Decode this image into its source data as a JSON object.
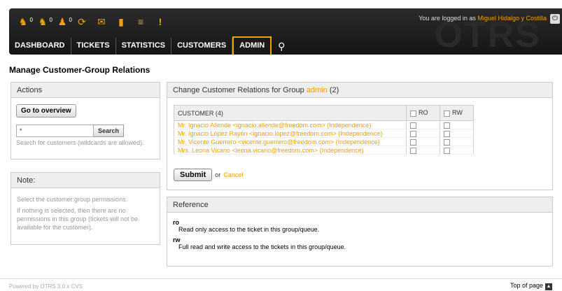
{
  "toolbar": {
    "icons": [
      {
        "name": "ticket-locked-icon",
        "count": "0"
      },
      {
        "name": "ticket-watched-icon",
        "count": "0"
      },
      {
        "name": "ticket-responsible-icon",
        "count": "0"
      },
      {
        "name": "refresh-icon",
        "count": ""
      },
      {
        "name": "email-icon",
        "count": ""
      },
      {
        "name": "folder-icon",
        "count": ""
      },
      {
        "name": "list-icon",
        "count": ""
      },
      {
        "name": "alert-icon",
        "count": ""
      }
    ],
    "logged_in_prefix": "You are logged in as",
    "user_name": "Miguel Hidalgo y Costilla",
    "logo_text": "OTRS"
  },
  "nav": {
    "items": [
      "DASHBOARD",
      "TICKETS",
      "STATISTICS",
      "CUSTOMERS",
      "ADMIN"
    ],
    "active": "ADMIN"
  },
  "page": {
    "title": "Manage Customer-Group Relations"
  },
  "actions": {
    "heading": "Actions",
    "overview_button": "Go to overview",
    "search_value": "*",
    "search_button": "Search",
    "search_hint": "Search for customers (wildcards are allowed)."
  },
  "note": {
    "heading": "Note:",
    "line1": "Select the customer:group permissions.",
    "line2": "If nothing is selected, then there are no permissions in this group (tickets will not be available for the customer)."
  },
  "relations": {
    "heading_prefix": "Change Customer Relations for Group",
    "group": "admin",
    "count": "(2)",
    "col_customer": "CUSTOMER (4)",
    "col_ro": "RO",
    "col_rw": "RW",
    "rows": [
      "Mr. Ignacio Allende <ignacio.allende@freedom.com> (Independence)",
      "Mr. Ignacio López Rayón <ignacio.lopez@freedom.com> (Independence)",
      "Mr. Vicente Guerrero <vicente.guerrero@freedom.com> (Independence)",
      "Mrs. Leona Vicario <leona.vicario@freedom.com> (Independence)"
    ],
    "submit": "Submit",
    "or": "or",
    "cancel": "Cancel"
  },
  "reference": {
    "heading": "Reference",
    "ro_term": "ro",
    "ro_desc": "Read only access to the ticket in this group/queue.",
    "rw_term": "rw",
    "rw_desc": "Full read and write access to the tickets in this group/queue."
  },
  "footer": {
    "powered": "Powered by OTRS 3.0.x CVS",
    "top": "Top of page"
  },
  "colors": {
    "accent": "#f0a000",
    "topbar": "#1c1c1c"
  }
}
